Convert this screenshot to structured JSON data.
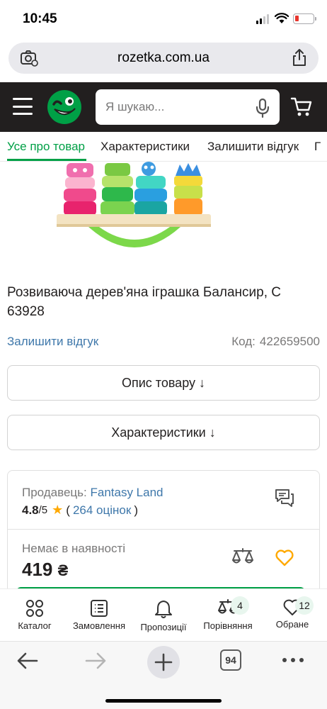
{
  "status_bar": {
    "time": "10:45"
  },
  "browser": {
    "url": "rozetka.com.ua",
    "tab_count": "94"
  },
  "header": {
    "search_placeholder": "Я шукаю..."
  },
  "tabs": [
    "Усе про товар",
    "Характеристики",
    "Залишити відгук",
    "Г"
  ],
  "product": {
    "title": "Розвиваюча дерев'яна іграшка Балансир, С 63928",
    "review_link": "Залишити відгук",
    "code_label": "Код:",
    "code_value": "422659500"
  },
  "buttons": {
    "description": "Опис товару ↓",
    "characteristics": "Характеристики ↓"
  },
  "seller": {
    "label": "Продавець:",
    "name": "Fantasy Land",
    "rating": "4.8",
    "rating_max": "/5",
    "reviews": "264 оцінок",
    "availability": "Немає в наявності",
    "price": "419",
    "currency": "₴"
  },
  "bottom_nav": {
    "items": [
      {
        "label": "Каталог",
        "icon": "catalog-icon"
      },
      {
        "label": "Замовлення",
        "icon": "orders-icon"
      },
      {
        "label": "Пропозиції",
        "icon": "bell-icon"
      },
      {
        "label": "Порівняння",
        "icon": "compare-icon",
        "badge": "4"
      },
      {
        "label": "Обране",
        "icon": "heart-icon",
        "badge": "12"
      }
    ]
  },
  "colors": {
    "brand_green": "#00a046",
    "header_dark": "#221f1f",
    "link_blue": "#3e77aa",
    "star": "#ffa900"
  }
}
